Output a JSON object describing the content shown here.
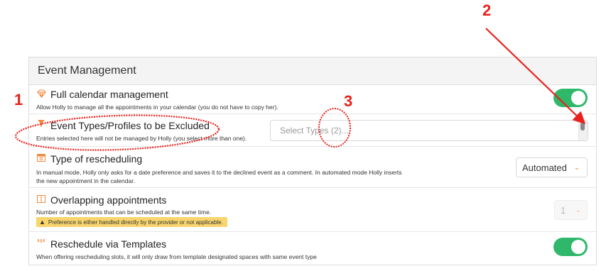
{
  "section": {
    "title": "Event Management"
  },
  "rows": {
    "full_calendar": {
      "title": "Full calendar management",
      "description": "Allow Holly to manage all the appointments in your calendar (you do not have to copy her)."
    },
    "excluded": {
      "title": "Event Types/Profiles to be Excluded",
      "description": "Entries selected here will not be managed by Holly (you select more than one).",
      "placeholder": "Select Types (2)..."
    },
    "rescheduling": {
      "title": "Type of rescheduling",
      "description": "In manual mode, Holly only asks for a date preference and saves it to the declined event as a comment. In automated mode Holly inserts the new appointment in the calendar.",
      "value": "Automated"
    },
    "overlapping": {
      "title": "Overlapping appointments",
      "description": "Number of appointments that can be scheduled at the same time.",
      "warning": "Preference is either handled directly by the provider or not applicable.",
      "value": "1"
    },
    "templates": {
      "title": "Reschedule via Templates",
      "description": "When offering rescheduling slots, it will only draw from template designated spaces with same event type"
    }
  },
  "annotations": {
    "one": "1",
    "two": "2",
    "three": "3"
  },
  "colors": {
    "accent": "#f08a3c",
    "toggle_on": "#2fb86a",
    "annotation": "#e8211c",
    "warning_bg": "#f9d56e"
  },
  "icons": {
    "full_calendar": "diamond-icon",
    "excluded": "filter-icon",
    "rescheduling": "calendar-icon",
    "overlapping": "columns-icon",
    "templates": "template-grid-icon",
    "warning": "warning-icon"
  }
}
